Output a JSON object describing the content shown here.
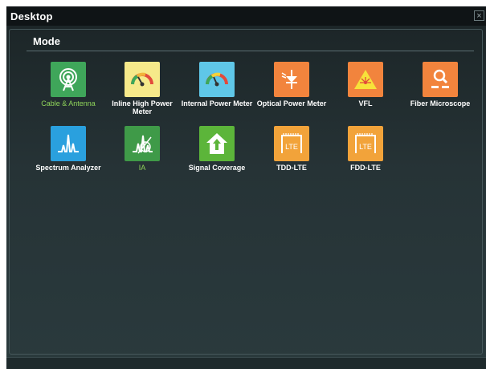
{
  "window": {
    "title": "Desktop",
    "close_glyph": "×"
  },
  "section": {
    "title": "Mode"
  },
  "apps": [
    {
      "label": "Cable & Antenna",
      "icon": "antenna-icon",
      "color": "#3fa65a",
      "highlight": true
    },
    {
      "label": "Inline High Power Meter",
      "icon": "gauge-icon",
      "color": "#f6e98a",
      "highlight": false
    },
    {
      "label": "Internal Power Meter",
      "icon": "gauge-icon",
      "color": "#5fc7e8",
      "highlight": false
    },
    {
      "label": "Optical Power Meter",
      "icon": "photodiode-icon",
      "color": "#f2843d",
      "highlight": false
    },
    {
      "label": "VFL",
      "icon": "laser-warning-icon",
      "color": "#f2843d",
      "highlight": false
    },
    {
      "label": "Fiber Microscope",
      "icon": "microscope-icon",
      "color": "#f2843d",
      "highlight": false
    },
    {
      "label": "Spectrum Analyzer",
      "icon": "spectrum-icon",
      "color": "#2aa0de",
      "highlight": false
    },
    {
      "label": "IA",
      "icon": "interference-icon",
      "color": "#3f9a48",
      "highlight": true
    },
    {
      "label": "Signal Coverage",
      "icon": "coverage-icon",
      "color": "#5cb53a",
      "highlight": false
    },
    {
      "label": "TDD-LTE",
      "icon": "lte-icon",
      "color": "#f2a33a",
      "highlight": false
    },
    {
      "label": "FDD-LTE",
      "icon": "lte-icon",
      "color": "#f2a33a",
      "highlight": false
    }
  ],
  "lte_glyph_text": "LTE"
}
